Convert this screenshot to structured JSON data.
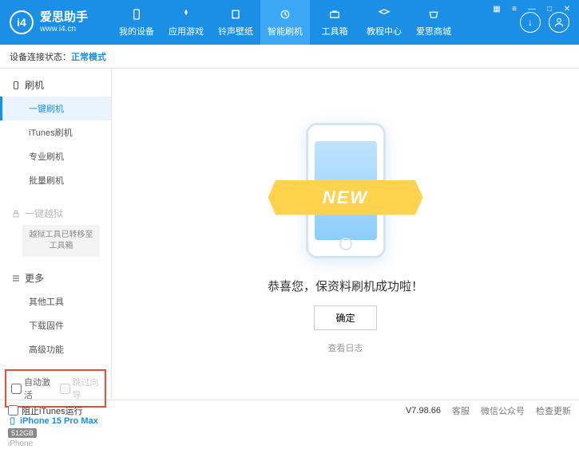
{
  "app": {
    "name": "爱思助手",
    "url": "www.i4.cn"
  },
  "winControls": {
    "menu": "▦",
    "restore": "≡",
    "min": "—",
    "max": "□",
    "close": "✕"
  },
  "nav": {
    "items": [
      {
        "label": "我的设备",
        "icon": "device"
      },
      {
        "label": "应用游戏",
        "icon": "apps"
      },
      {
        "label": "铃声壁纸",
        "icon": "ringtone"
      },
      {
        "label": "智能刷机",
        "icon": "flash"
      },
      {
        "label": "工具箱",
        "icon": "toolbox"
      },
      {
        "label": "教程中心",
        "icon": "tutorial"
      },
      {
        "label": "爱思商城",
        "icon": "store"
      }
    ],
    "activeIndex": 3
  },
  "rightCircles": {
    "download": "↓",
    "user": "👤"
  },
  "statusBar": {
    "label": "设备连接状态：",
    "mode": "正常模式"
  },
  "sidebar": {
    "flash": {
      "title": "刷机",
      "items": [
        "一键刷机",
        "iTunes刷机",
        "专业刷机",
        "批量刷机"
      ],
      "activeIndex": 0
    },
    "jailbreak": {
      "title": "一键越狱",
      "note": "越狱工具已转移至工具箱"
    },
    "more": {
      "title": "更多",
      "items": [
        "其他工具",
        "下载固件",
        "高级功能"
      ]
    },
    "checks": {
      "autoActivate": "自动激活",
      "skipSetup": "跳过向导"
    },
    "device": {
      "name": "iPhone 15 Pro Max",
      "storage": "512GB",
      "type": "iPhone"
    }
  },
  "content": {
    "newBadge": "NEW",
    "message": "恭喜您，保资料刷机成功啦！",
    "okBtn": "确定",
    "logLink": "查看日志"
  },
  "footer": {
    "blockItunes": "阻止iTunes运行",
    "version": "V7.98.66",
    "links": [
      "客服",
      "微信公众号",
      "检查更新"
    ]
  }
}
